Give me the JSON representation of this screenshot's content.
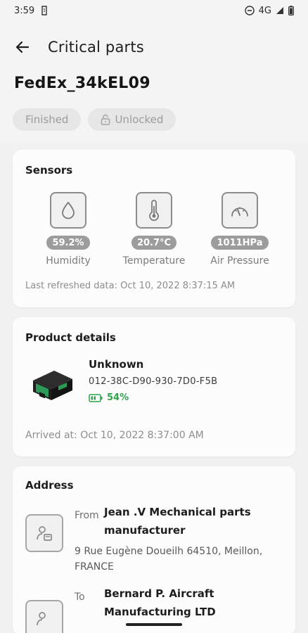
{
  "status_bar": {
    "time": "3:59",
    "network": "4G"
  },
  "appbar": {
    "title": "Critical parts"
  },
  "shipment": {
    "id": "FedEx_34kEL09",
    "chips": [
      {
        "label": "Finished"
      },
      {
        "label": "Unlocked"
      }
    ]
  },
  "sensors": {
    "title": "Sensors",
    "items": [
      {
        "icon": "drop-icon",
        "value": "59.2%",
        "label": "Humidity"
      },
      {
        "icon": "thermometer-icon",
        "value": "20.7°C",
        "label": "Temperature"
      },
      {
        "icon": "gauge-icon",
        "value": "1011HPa",
        "label": "Air Pressure"
      }
    ],
    "last_refreshed": "Last refreshed data: Oct 10, 2022 8:37:15 AM"
  },
  "product": {
    "title": "Product details",
    "name": "Unknown",
    "serial": "012-38C-D90-930-7D0-F5B",
    "battery": "54%",
    "arrived": "Arrived at: Oct 10, 2022 8:37:00 AM"
  },
  "address": {
    "title": "Address",
    "from": {
      "direction": "From",
      "name": "Jean .V Mechanical parts manufacturer",
      "line": "9 Rue Eugène Doueilh 64510, Meillon, FRANCE"
    },
    "to": {
      "direction": "To",
      "name": "Bernard P. Aircraft Manufacturing LTD"
    }
  },
  "colors": {
    "accent_green": "#2ba24c",
    "chip_bg": "#e6e6e6",
    "badge_gray": "#9c9c9c"
  }
}
